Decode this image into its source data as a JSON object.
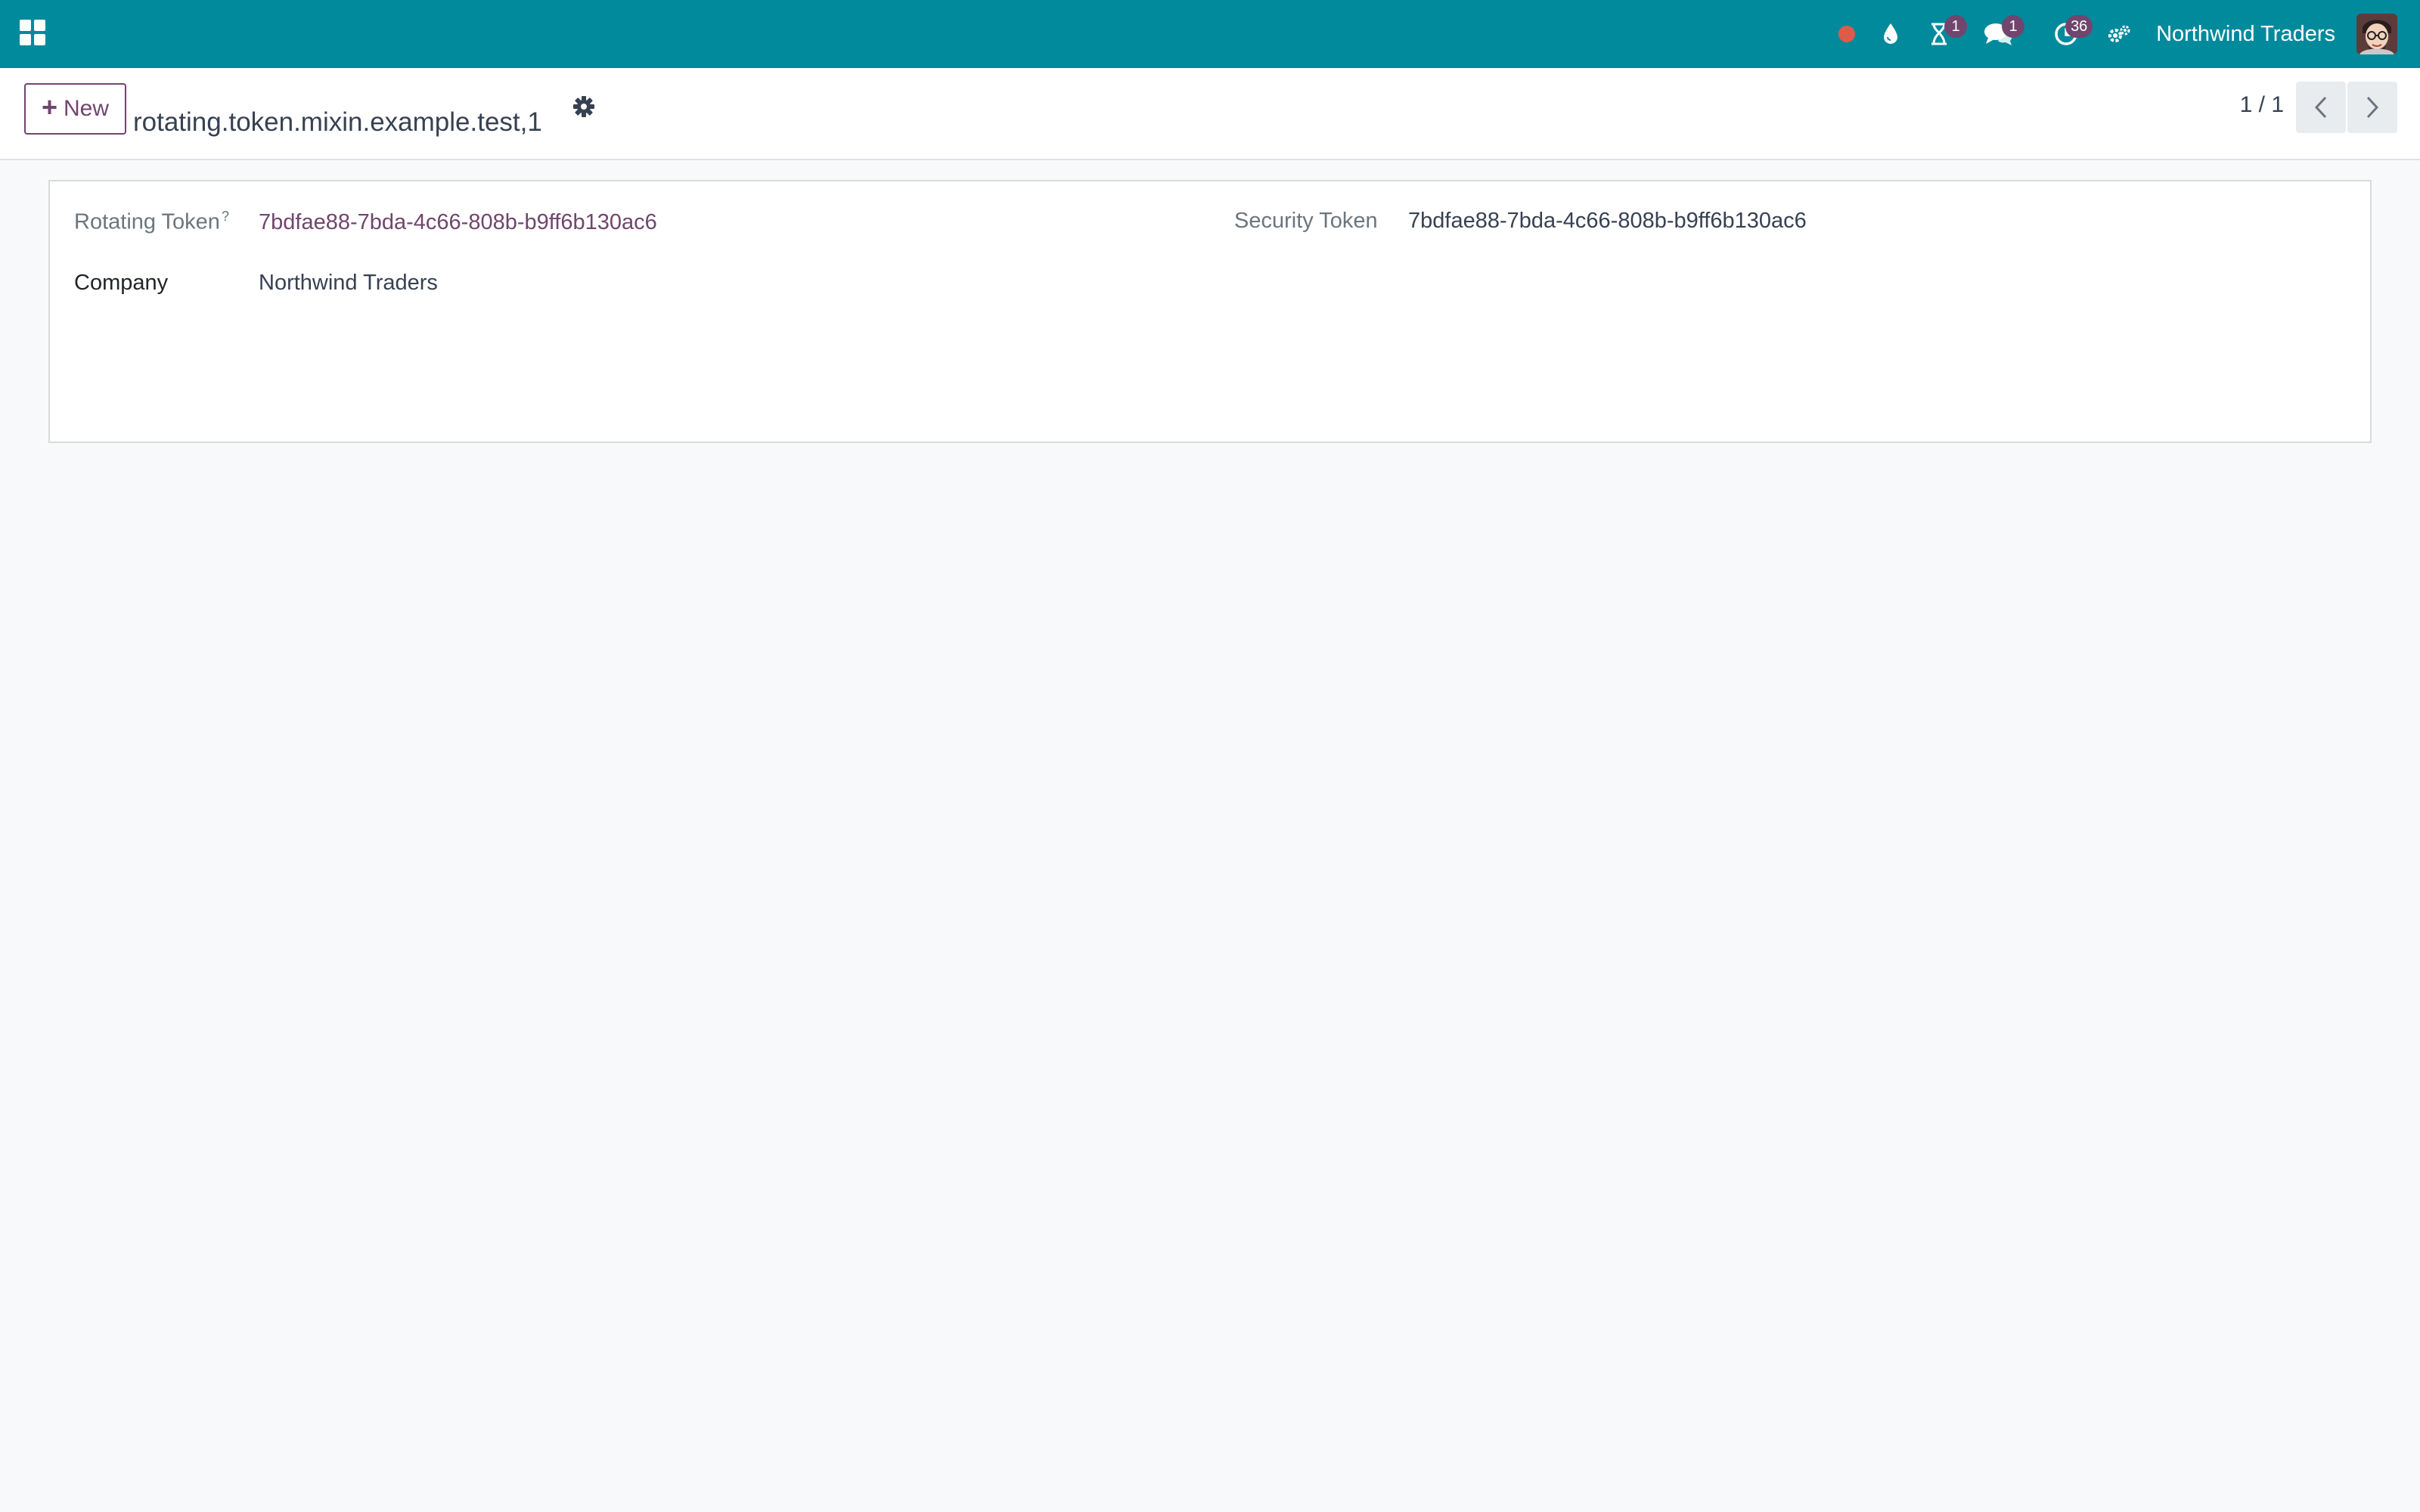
{
  "navbar": {
    "company": "Northwind Traders",
    "badges": {
      "activities_timer": "1",
      "messages": "1",
      "activities": "36"
    },
    "colors": {
      "bar": "#018a9c",
      "badge": "#71456d",
      "recording": "#e05a4a"
    }
  },
  "control_panel": {
    "new_label": "New",
    "record_title": "rotating.token.mixin.example.test,1",
    "pager": "1 / 1"
  },
  "form": {
    "rotating_token_label": "Rotating Token",
    "rotating_token_help": "?",
    "rotating_token_value": "7bdfae88-7bda-4c66-808b-b9ff6b130ac6",
    "security_token_label": "Security Token",
    "security_token_value": "7bdfae88-7bda-4c66-808b-b9ff6b130ac6",
    "company_label": "Company",
    "company_value": "Northwind Traders"
  },
  "icons": [
    "apps-icon",
    "recording-dot-icon",
    "droplet-icon",
    "hourglass-icon",
    "chat-icon",
    "clock-icon",
    "settings-gears-icon",
    "avatar",
    "gear-icon",
    "chevron-left-icon",
    "chevron-right-icon",
    "plus-icon"
  ]
}
